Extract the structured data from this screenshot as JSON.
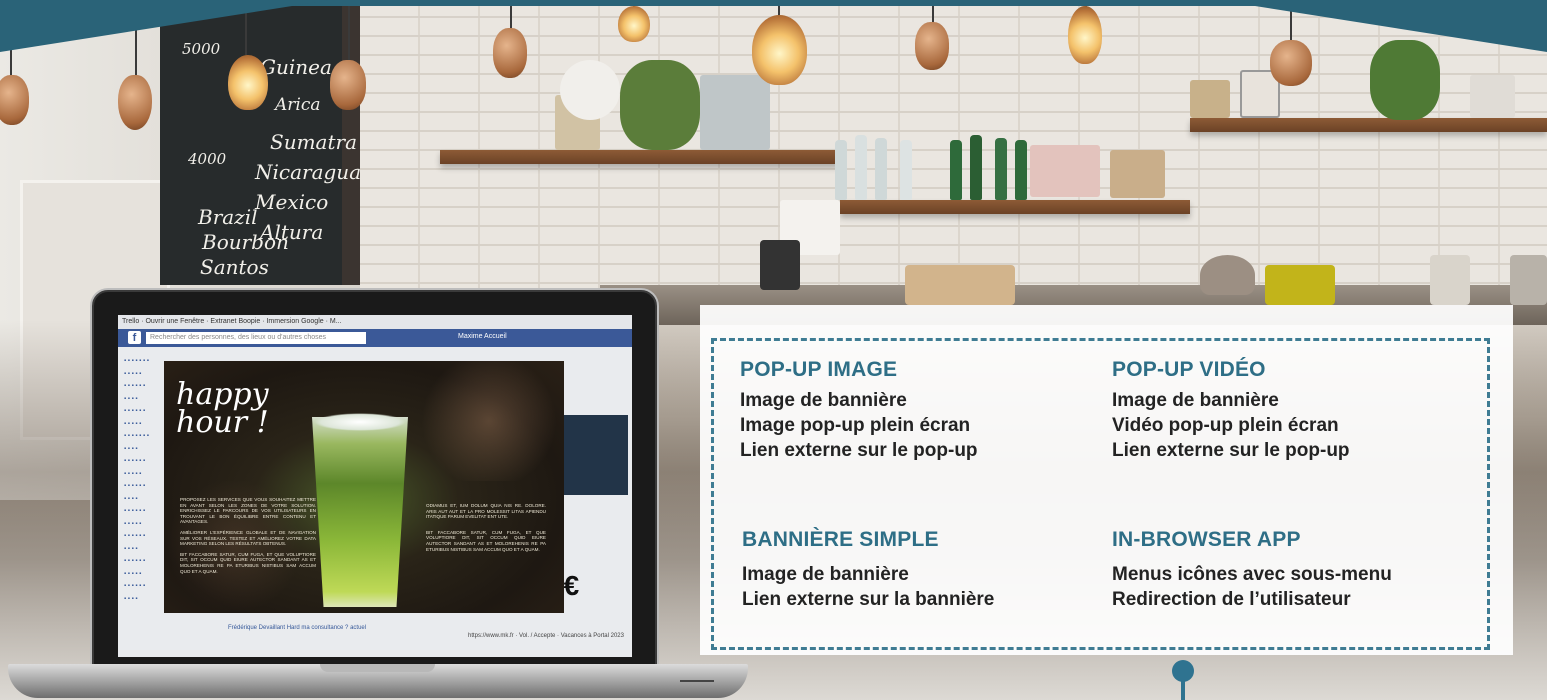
{
  "panel": {
    "sections": [
      {
        "title": "POP-UP IMAGE",
        "items": [
          "Image de bannière",
          "Image pop-up plein écran",
          "Lien externe sur le pop-up"
        ]
      },
      {
        "title": "POP-UP VIDÉO",
        "items": [
          "Image de bannière",
          "Vidéo pop-up plein écran",
          "Lien externe sur le pop-up"
        ]
      },
      {
        "title": "BANNIÈRE SIMPLE",
        "items": [
          "Image de bannière",
          "Lien externe sur la bannière"
        ]
      },
      {
        "title": "IN-BROWSER APP",
        "items": [
          "Menus icônes avec sous-menu",
          "Redirection de l’utilisateur"
        ]
      }
    ]
  },
  "colors": {
    "accent": "#2e6e86",
    "banner": "#2a6378",
    "text": "#232323"
  },
  "laptop": {
    "browser_tabs": "Trello  ·  Ouvrir une Fenêtre  ·  Extranet Boopie  ·  Immersion Google · M...",
    "fb_search": "Rechercher des personnes, des lieux ou d'autres choses",
    "fb_nav": "Maxime   Accueil",
    "popup_title": "happy\nhour !",
    "popup_left_text": [
      "PROPOSEZ LES SERVICES QUE VOUS SOUHAITEZ METTRE EN AVANT SELON LES ZONES DE VOTRE SOLUTION. ENRICHISSEZ LE PARCOURS DE VOS UTILISATEURS EN TROUVANT LE BON ÉQUILIBRE ENTRE CONTENU ET AVANTAGES.",
      "AMÉLIORER L'EXPÉRIENCE GLOBALE ET DE NAVIGATION SUR VOS RÉSEAUX. TESTEZ ET AMÉLIOREZ VOTRE DATA MARKETING SELON LES RÉSULTATS OBTENUS.",
      "BIT FACCABORE SATUR, CUM FUGA, ET QUE VOLUPTIORE DIT, SIT OCCUM QUID EIURE AUTECTOR SANDANT AS ET MOLOREHENIS RE PA ETURIBUS NISTIBUS SAM ACCUM QUO ET A QUAM."
    ],
    "popup_right_text": [
      "ODIAMUS ET, IUM DOLUM QUIA NIS RE. DOLORE. ARIS AUT AUT ET LA PRO MOLESSIT LITAS APIENDU ITATIQUE PARUM EVELITAT ENT UTE.",
      "BIT FACCABORE SATUR, CUM FUGA, ET QUE VOLUPTIORE DIT, SIT OCCUM QUID EIURE AUTECTOR SANDANT AS ET MOLOREHENIS RE PA ETURIBUS NISTIBUS SAM ACCUM QUO ET A QUAM."
    ],
    "fb_feed": "Frédérique Devaillant Hard ma consultance ? actuel",
    "fb_right": "https://www.mk.fr · Vol. / Accepte · Vacances à Portal 2023"
  }
}
